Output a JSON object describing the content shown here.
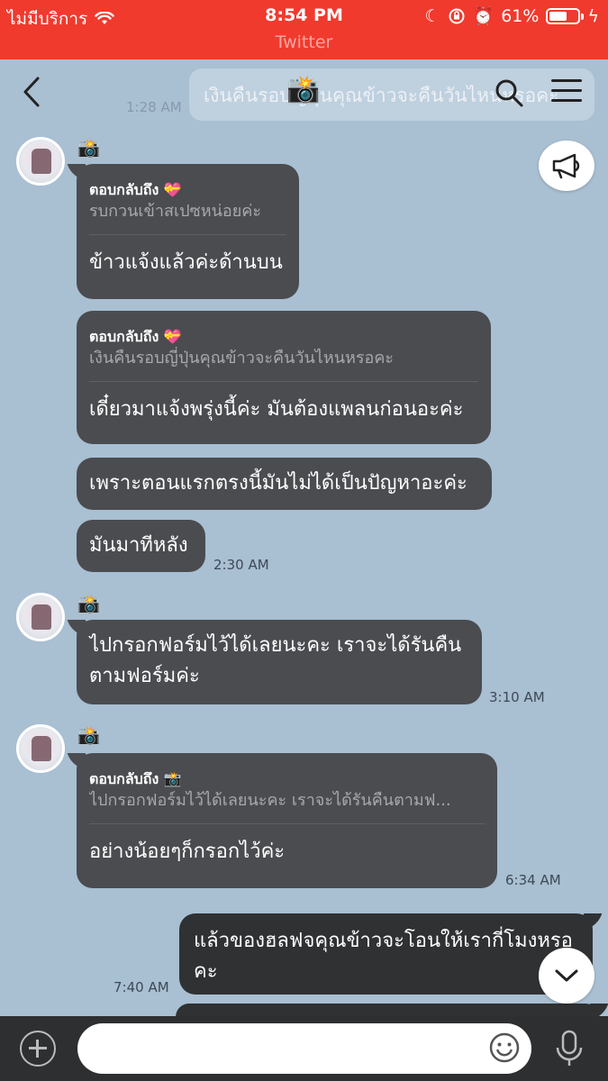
{
  "status_bar": {
    "carrier": "ไม่มีบริการ",
    "time": "8:54 PM",
    "battery_percent": "61%",
    "battery_level": 0.61,
    "return_to_app": "Twitter"
  },
  "header": {
    "title_icon": "📸",
    "pinned_message": "เงินคืนรอบญี่ปุ่นคุณข้าวจะคืนวันไหนหรอคะ",
    "pinned_time": "1:28 AM"
  },
  "messages": [
    {
      "sender_icon": "📸",
      "reply_label": "ตอบกลับถึง 💝",
      "reply_text": "รบกวนเข้าสเปซหน่อยค่ะ",
      "text": "ข้าวแจ้งแล้วค่ะด้านบน"
    },
    {
      "reply_label": "ตอบกลับถึง 💝",
      "reply_text": "เงินคืนรอบญี่ปุ่นคุณข้าวจะคืนวันไหนหรอคะ",
      "text": "เดี๋ยวมาแจ้งพรุ่งนี้ค่ะ มันต้องแพลนก่อนอะค่ะ"
    },
    {
      "text": "เพราะตอนแรกตรงนี้มันไม่ได้เป็นปัญหาอะค่ะ"
    },
    {
      "text": "มันมาทีหลัง",
      "time": "2:30 AM"
    },
    {
      "sender_icon": "📸",
      "text_line1": "ไปกรอกฟอร์มไว้ได้เลยนะคะ เราจะได้รันคืน",
      "text_line2": "ตามฟอร์มค่ะ",
      "time": "3:10 AM"
    },
    {
      "sender_icon": "📸",
      "reply_label": "ตอบกลับถึง 📸",
      "reply_text": "ไปกรอกฟอร์มไว้ได้เลยนะคะ เราจะได้รันคืนตามฟ...",
      "text": "อย่างน้อยๆก็กรอกไว้ค่ะ",
      "time": "6:34 AM"
    },
    {
      "outgoing": true,
      "text_line1": "แล้วของฮลฟจคุณข้าวจะโอนให้เรากี่โมงหรอ",
      "text_line2": "คะ",
      "time": "7:40 AM"
    }
  ],
  "icons": {
    "announcement": "megaphone-icon",
    "scroll": "chevron-down-icon",
    "back": "chevron-left-icon",
    "search": "search-icon",
    "menu": "menu-icon",
    "add": "plus-icon",
    "emoji": "smiley-icon",
    "mic": "microphone-icon"
  },
  "colors": {
    "status_bar": "#f03a2e",
    "chat_background": "#a9bfd2",
    "incoming_bubble": "#4a4c50",
    "outgoing_bubble": "#2f3133",
    "input_bar": "#2e2f31"
  },
  "input": {
    "value": ""
  }
}
